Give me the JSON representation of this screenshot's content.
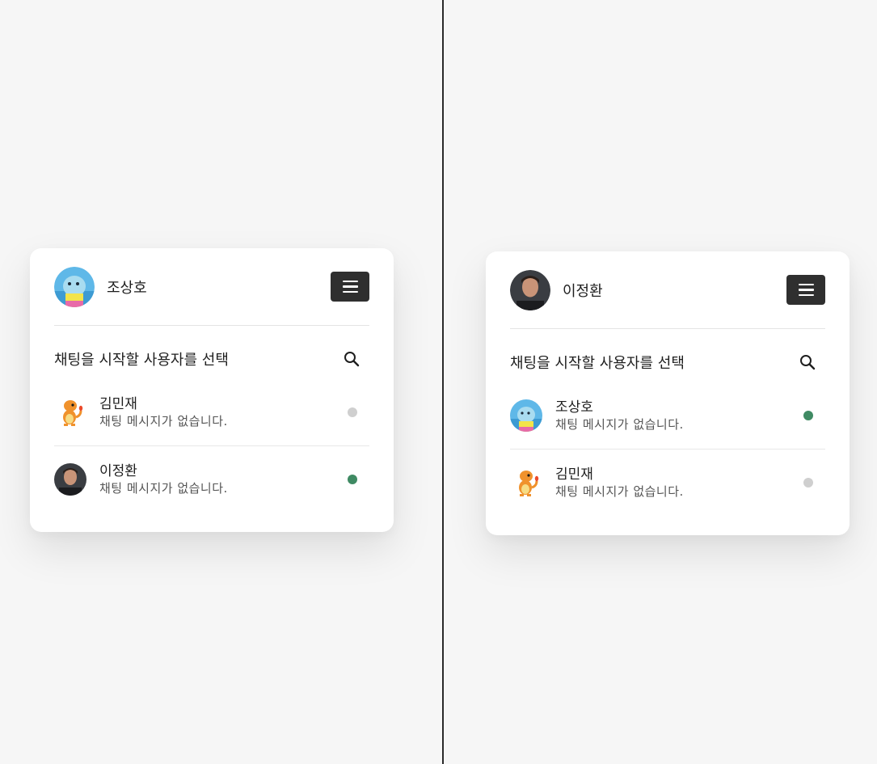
{
  "panels": [
    {
      "current_user": {
        "name": "조상호",
        "avatar": "dino-avatar"
      },
      "select_title": "채팅을 시작할 사용자를 선택",
      "users": [
        {
          "name": "김민재",
          "message": "채팅 메시지가 없습니다.",
          "avatar": "charmander-avatar",
          "status": "offline"
        },
        {
          "name": "이정환",
          "message": "채팅 메시지가 없습니다.",
          "avatar": "man-photo-avatar",
          "status": "online"
        }
      ]
    },
    {
      "current_user": {
        "name": "이정환",
        "avatar": "man-photo-avatar"
      },
      "select_title": "채팅을 시작할 사용자를 선택",
      "users": [
        {
          "name": "조상호",
          "message": "채팅 메시지가 없습니다.",
          "avatar": "dino-avatar",
          "status": "online"
        },
        {
          "name": "김민재",
          "message": "채팅 메시지가 없습니다.",
          "avatar": "charmander-avatar",
          "status": "offline"
        }
      ]
    }
  ],
  "colors": {
    "online": "#3f8a63",
    "offline": "#cfcfcf",
    "menu_button": "#2f2f2f"
  },
  "icons": {
    "menu": "hamburger-icon",
    "search": "search-icon"
  }
}
